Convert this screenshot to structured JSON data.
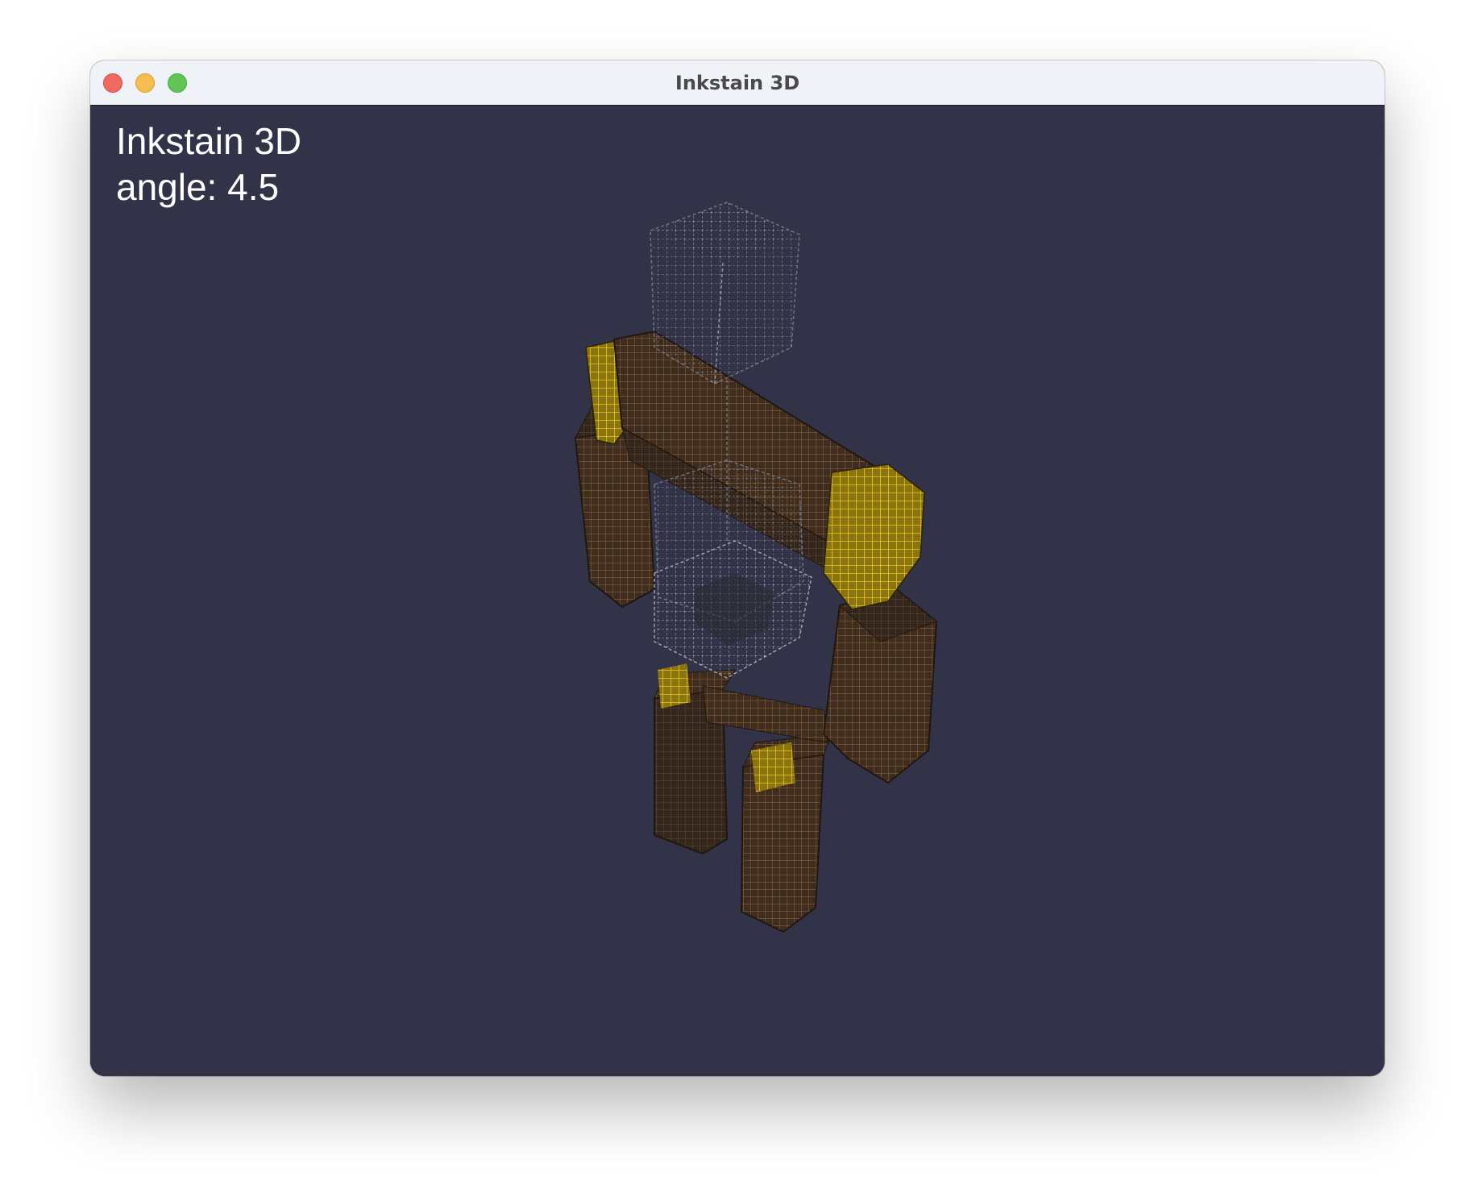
{
  "window": {
    "title": "Inkstain 3D",
    "traffic_lights": {
      "close_color": "#ee6a5f",
      "minimize_color": "#f5be4f",
      "maximize_color": "#61c554"
    }
  },
  "overlay": {
    "title": "Inkstain 3D",
    "angle_text": "angle: 4.5"
  },
  "scene": {
    "background": "#323248",
    "model": "voxel robot figure",
    "parts": [
      {
        "name": "head",
        "color": "#8a8e98",
        "style": "wireframe"
      },
      {
        "name": "torso",
        "color": "#8a8e98",
        "style": "wireframe"
      },
      {
        "name": "shoulder-bar",
        "color": "#5a3d22"
      },
      {
        "name": "left-arm",
        "color": "#5a3d22"
      },
      {
        "name": "right-arm",
        "color": "#5a3d22"
      },
      {
        "name": "left-shoulder-pad",
        "color": "#c9a81a"
      },
      {
        "name": "right-shoulder-pad",
        "color": "#c9a81a"
      },
      {
        "name": "left-leg",
        "color": "#5a3d22"
      },
      {
        "name": "right-leg",
        "color": "#5a3d22"
      },
      {
        "name": "hip-joint-left",
        "color": "#c9a81a"
      },
      {
        "name": "hip-joint-right",
        "color": "#c9a81a"
      }
    ]
  }
}
